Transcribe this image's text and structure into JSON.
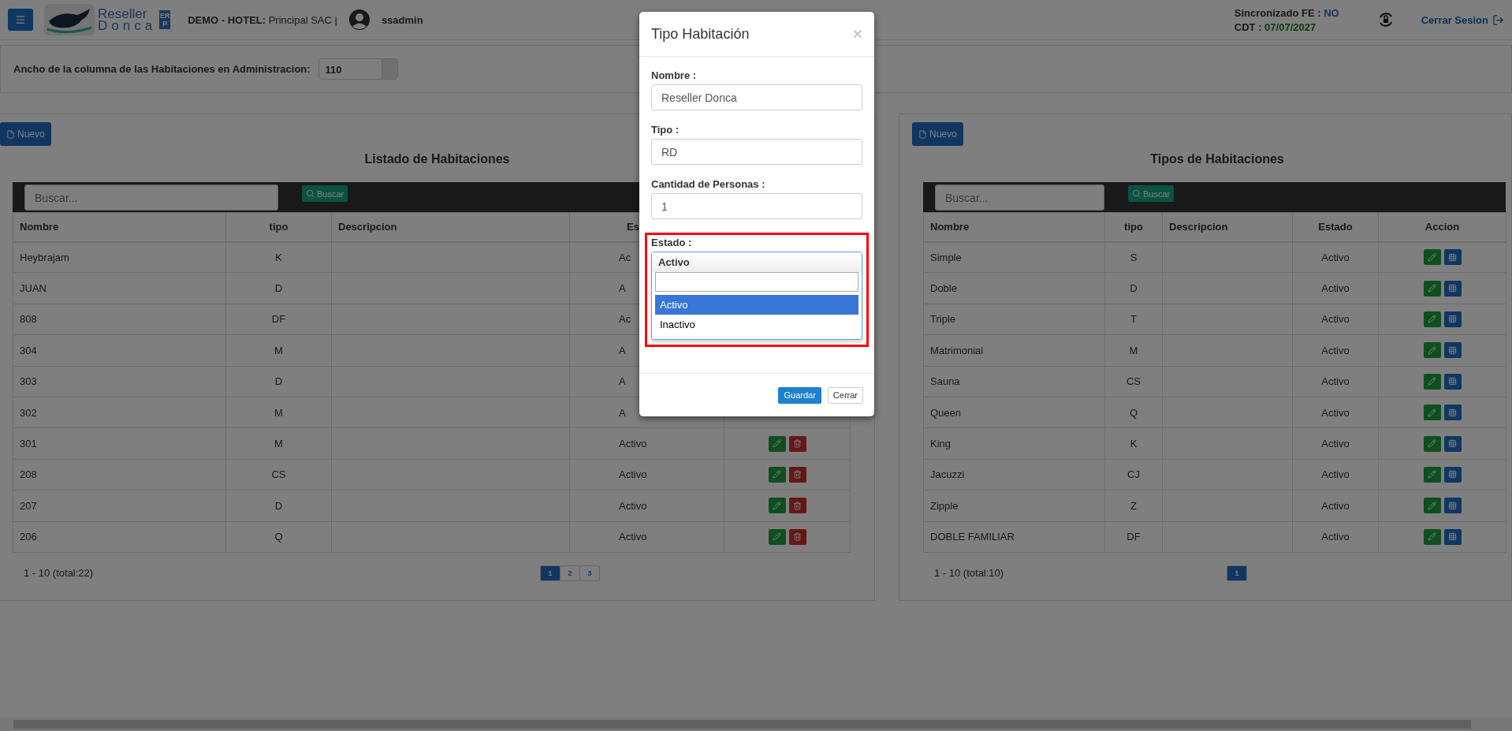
{
  "header": {
    "logo": {
      "line1": "Reseller",
      "line2": "Donca",
      "badge": "ERP"
    },
    "company": "**DEMO - HOTEL:** Principal SAC |",
    "user": "ssadmin",
    "sync_label": "Sincronizado FE :",
    "sync_value": "NO",
    "cdt_label": "CDT :",
    "cdt_value": "07/07/2027",
    "logout": "Cerrar Sesion"
  },
  "settings": {
    "label": "Ancho de la columna de las Habitaciones en Administracion:",
    "value": "110"
  },
  "rooms": {
    "new_button": "Nuevo",
    "title": "Listado de Habitaciones",
    "search": {
      "placeholder": "Buscar...",
      "button": "Buscar"
    },
    "columns": [
      "Nombre",
      "tipo",
      "Descripcion",
      "Es"
    ],
    "row_actions": [
      {
        "kind": "edit"
      },
      {
        "kind": "delete"
      }
    ],
    "rows": [
      {
        "kind": "partial",
        "name": "Heybrajam",
        "tipo": "K",
        "estado": "Ac"
      },
      {
        "kind": "partial",
        "name": "JUAN",
        "tipo": "D",
        "estado": "A"
      },
      {
        "kind": "partial",
        "name": "808",
        "tipo": "DF",
        "estado": "Ac"
      },
      {
        "kind": "partial",
        "name": "304",
        "tipo": "M",
        "estado": "A"
      },
      {
        "kind": "partial",
        "name": "303",
        "tipo": "D",
        "estado": "A"
      },
      {
        "kind": "partial",
        "name": "302",
        "tipo": "M",
        "estado": "A"
      },
      {
        "kind": "full",
        "name": "301",
        "tipo": "M",
        "estado": "Activo"
      },
      {
        "kind": "full",
        "name": "208",
        "tipo": "CS",
        "estado": "Activo"
      },
      {
        "kind": "full",
        "name": "207",
        "tipo": "D",
        "estado": "Activo"
      },
      {
        "kind": "full",
        "name": "206",
        "tipo": "Q",
        "estado": "Activo"
      }
    ],
    "summary": "1 - 10 (total:22)",
    "pages": [
      {
        "label": "1",
        "selected": true
      },
      {
        "label": "2",
        "selected": false
      },
      {
        "label": "3",
        "selected": false
      }
    ]
  },
  "types": {
    "new_button": "Nuevo",
    "title": "Tipos de Habitaciones",
    "search": {
      "placeholder": "Buscar...",
      "button": "Buscar"
    },
    "columns": [
      "Nombre",
      "tipo",
      "Descripcion",
      "Estado",
      "Accion"
    ],
    "row_actions": [
      {
        "kind": "edit"
      },
      {
        "kind": "grid"
      }
    ],
    "rows": [
      {
        "kind": "full",
        "name": "Simple",
        "tipo": "S",
        "estado": "Activo"
      },
      {
        "kind": "full",
        "name": "Doble",
        "tipo": "D",
        "estado": "Activo"
      },
      {
        "kind": "full",
        "name": "Triple",
        "tipo": "T",
        "estado": "Activo"
      },
      {
        "kind": "full",
        "name": "Matrimonial",
        "tipo": "M",
        "estado": "Activo"
      },
      {
        "kind": "full",
        "name": "Sauna",
        "tipo": "CS",
        "estado": "Activo"
      },
      {
        "kind": "full",
        "name": "Queen",
        "tipo": "Q",
        "estado": "Activo"
      },
      {
        "kind": "full",
        "name": "King",
        "tipo": "K",
        "estado": "Activo"
      },
      {
        "kind": "full",
        "name": "Jacuzzi",
        "tipo": "CJ",
        "estado": "Activo"
      },
      {
        "kind": "full",
        "name": "Zipple",
        "tipo": "Z",
        "estado": "Activo"
      },
      {
        "kind": "full",
        "name": "DOBLE FAMILIAR",
        "tipo": "DF",
        "estado": "Activo"
      }
    ],
    "summary": "1 - 10 (total:10)",
    "pages": [
      {
        "label": "1",
        "selected": true
      }
    ]
  },
  "modal": {
    "title": "Tipo Habitación",
    "close": "×",
    "fields": [
      {
        "label": "Nombre :",
        "value": "Reseller Donca"
      },
      {
        "label": "Tipo :",
        "value": "RD"
      },
      {
        "label": "Cantidad de Personas :",
        "value": "1"
      }
    ],
    "estado": {
      "label": "Estado :",
      "highlighted": true,
      "value": "Activo",
      "options": [
        {
          "label": "Activo",
          "selected": true
        },
        {
          "label": "Inactivo",
          "selected": false
        }
      ]
    },
    "buttons": [
      {
        "kind": "primary",
        "label": "Guardar"
      },
      {
        "kind": "default",
        "label": "Cerrar"
      }
    ]
  }
}
